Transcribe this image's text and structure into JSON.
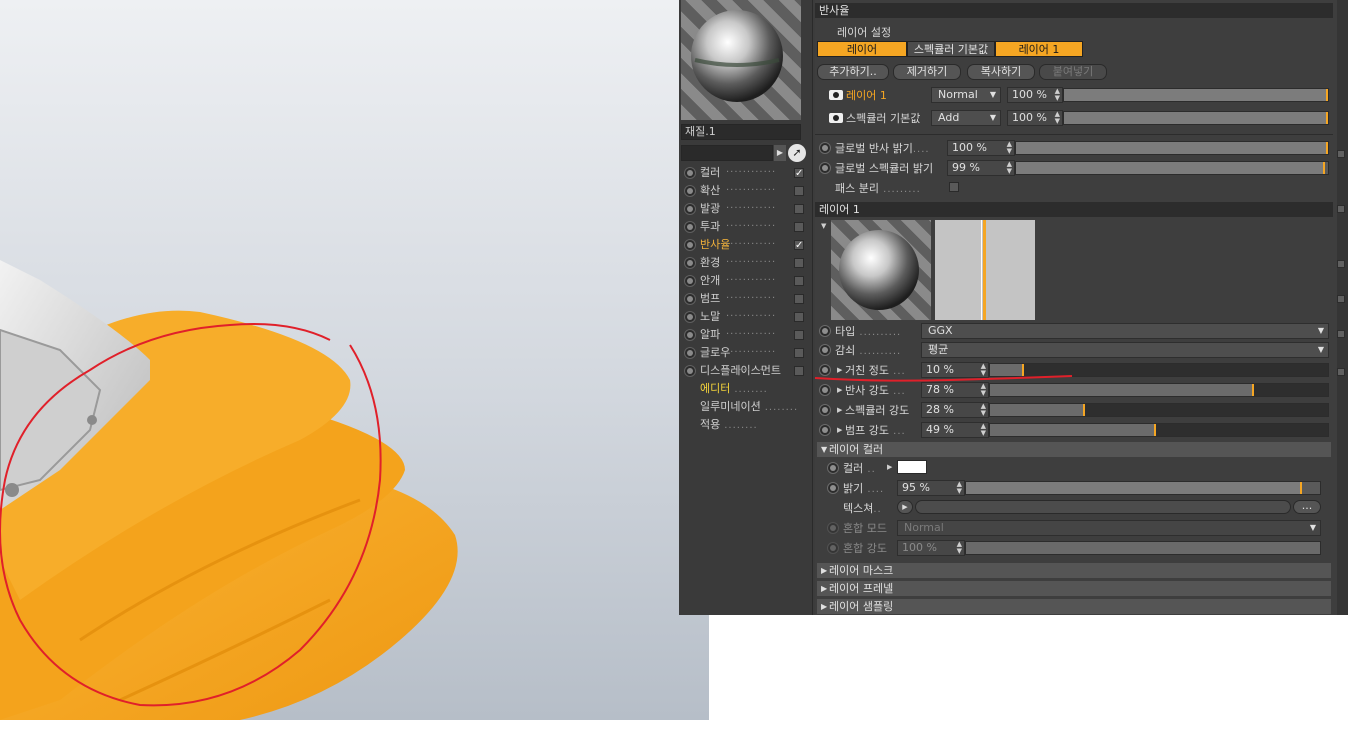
{
  "sidebar": {
    "material_name": "재질.1",
    "channels": [
      {
        "label": "컬러",
        "checked": true,
        "active": false
      },
      {
        "label": "확산",
        "checked": false,
        "active": false
      },
      {
        "label": "발광",
        "checked": false,
        "active": false
      },
      {
        "label": "투과",
        "checked": false,
        "active": false
      },
      {
        "label": "반사율",
        "checked": true,
        "active": true
      },
      {
        "label": "환경",
        "checked": false,
        "active": false
      },
      {
        "label": "안개",
        "checked": false,
        "active": false
      },
      {
        "label": "범프",
        "checked": false,
        "active": false
      },
      {
        "label": "노말",
        "checked": false,
        "active": false
      },
      {
        "label": "알파",
        "checked": false,
        "active": false
      },
      {
        "label": "글로우",
        "checked": false,
        "active": false
      },
      {
        "label": "디스플레이스먼트",
        "checked": false,
        "active": false
      }
    ],
    "extra": [
      {
        "label": "에디터",
        "active": true
      },
      {
        "label": "일루미네이션",
        "active": false
      },
      {
        "label": "적용",
        "active": false
      }
    ],
    "check_glyph": "✓",
    "cursor_glyph": "➚"
  },
  "reflectance": {
    "title": "반사율",
    "layer_settings_label": "레이어 설정",
    "tabs": {
      "layer": "레이어",
      "specular_default": "스펙큘러 기본값",
      "layer1": "레이어 1"
    },
    "buttons": {
      "add": "추가하기..",
      "remove": "제거하기",
      "copy": "복사하기",
      "paste": "붙여넣기"
    },
    "layer_rows": [
      {
        "name": "레이어 1",
        "blend": "Normal",
        "amount": "100 %",
        "fill": 1.0
      },
      {
        "name": "스펙큘러 기본값",
        "blend": "Add",
        "amount": "100 %",
        "fill": 1.0
      }
    ],
    "global_reflection_label": "글로벌 반사 밝기",
    "global_reflection_value": "100 %",
    "global_reflection_fill": 1.0,
    "global_specular_label": "글로벌 스펙큘러 밝기",
    "global_specular_value": "99 %",
    "global_specular_fill": 0.99,
    "pass_separation_label": "패스 분리"
  },
  "layer1": {
    "title": "레이어 1",
    "type_label": "타입",
    "type_value": "GGX",
    "attenuation_label": "감쇠",
    "attenuation_value": "평균",
    "roughness_label": "거친 정도",
    "roughness_value": "10 %",
    "roughness_fill": 0.1,
    "reflect_strength_label": "반사 강도",
    "reflect_strength_value": "78 %",
    "reflect_strength_fill": 0.78,
    "specular_strength_label": "스펙큘러 강도",
    "specular_strength_value": "28 %",
    "specular_strength_fill": 0.28,
    "bump_strength_label": "범프 강도",
    "bump_strength_value": "49 %",
    "bump_strength_fill": 0.49,
    "layer_color_header": "레이어 컬러",
    "color_label": "컬러",
    "color_swatch": "#ffffff",
    "brightness_label": "밝기",
    "brightness_value": "95 %",
    "brightness_fill": 0.95,
    "texture_label": "텍스쳐",
    "more_button": "...",
    "blend_mode_label": "혼합 모드",
    "blend_mode_value": "Normal",
    "blend_strength_label": "혼합 강도",
    "blend_strength_value": "100 %",
    "blend_strength_fill": 1.0,
    "collapsed": [
      "레이어 마스크",
      "레이어 프레넬",
      "레이어 샘플링"
    ]
  },
  "colors": {
    "accent": "#f5a623",
    "render_orange": "#f6a822",
    "annotation_red": "#e0202a"
  }
}
